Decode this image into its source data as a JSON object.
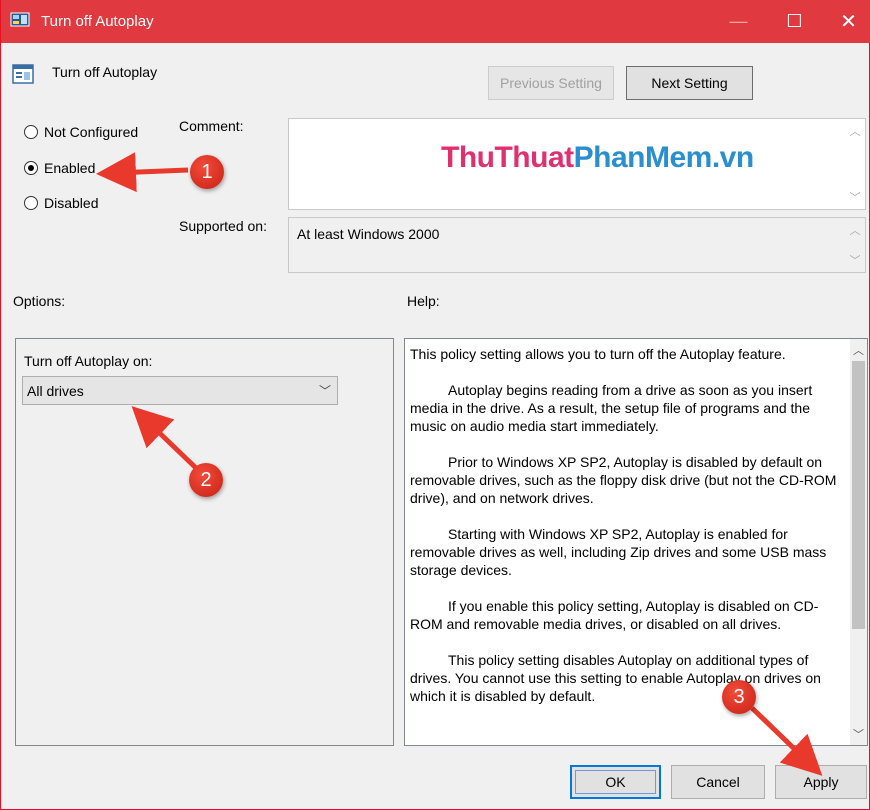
{
  "window": {
    "title": "Turn off Autoplay",
    "minimize_glyph": "—",
    "maximize_glyph": "☐",
    "close_glyph": "✕"
  },
  "header": {
    "title": "Turn off Autoplay",
    "prev_label": "Previous Setting",
    "next_label": "Next Setting"
  },
  "state": {
    "options": [
      {
        "label": "Not Configured",
        "checked": false
      },
      {
        "label": "Enabled",
        "checked": true
      },
      {
        "label": "Disabled",
        "checked": false
      }
    ]
  },
  "comment": {
    "label": "Comment:",
    "watermark": {
      "part1": "ThuThuat",
      "part2": "PhanMem",
      "part3": ".vn"
    }
  },
  "supported": {
    "label": "Supported on:",
    "value": "At least Windows 2000"
  },
  "options": {
    "label": "Options:",
    "sub_label": "Turn off Autoplay on:",
    "dropdown_value": "All drives"
  },
  "help": {
    "label": "Help:",
    "paragraphs": [
      "This policy setting allows you to turn off the Autoplay feature.",
      "Autoplay begins reading from a drive as soon as you insert media in the drive. As a result, the setup file of programs and the music on audio media start immediately.",
      "Prior to Windows XP SP2, Autoplay is disabled by default on removable drives, such as the floppy disk drive (but not the CD-ROM drive), and on network drives.",
      "Starting with Windows XP SP2, Autoplay is enabled for removable drives as well, including Zip drives and some USB mass storage devices.",
      "If you enable this policy setting, Autoplay is disabled on CD-ROM and removable media drives, or disabled on all drives.",
      "This policy setting disables Autoplay on additional types of drives. You cannot use this setting to enable Autoplay on drives on which it is disabled by default."
    ]
  },
  "footer": {
    "ok_label": "OK",
    "cancel_label": "Cancel",
    "apply_label": "Apply"
  },
  "annotations": {
    "badge1": "1",
    "badge2": "2",
    "badge3": "3",
    "color": "#e8392c"
  },
  "colors": {
    "titlebar": "#e0393f",
    "watermark_pink": "#e0306e",
    "watermark_blue": "#2a8fd0",
    "ok_border": "#0078d7"
  }
}
